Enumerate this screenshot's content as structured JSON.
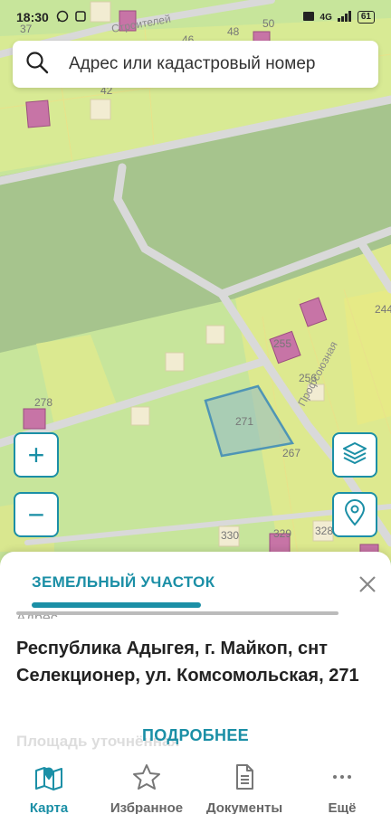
{
  "status_bar": {
    "time": "18:30",
    "network": "4G",
    "battery": "61"
  },
  "search": {
    "placeholder": "Адрес или кадастровый номер"
  },
  "map": {
    "street_label": "Строителей",
    "street_label_2": "Профсоюзная",
    "parcel_numbers": [
      "37",
      "46",
      "48",
      "50",
      "42",
      "244",
      "255",
      "256",
      "278",
      "271",
      "267",
      "330",
      "329",
      "328"
    ]
  },
  "map_controls": {
    "zoom_in": "+",
    "zoom_out": "−"
  },
  "sheet": {
    "tab_label": "ЗЕМЕЛЬНЫЙ УЧАСТОК",
    "address_label": "Адрес",
    "address_value": "Республика Адыгея, г. Майкоп, снт Селекционер, ул. Комсомольская, 271",
    "more_button": "ПОДРОБНЕЕ",
    "area_label": "Площадь уточнённая"
  },
  "bottom_nav": {
    "items": [
      {
        "label": "Карта",
        "icon": "map-icon",
        "active": true
      },
      {
        "label": "Избранное",
        "icon": "star-icon",
        "active": false
      },
      {
        "label": "Документы",
        "icon": "document-icon",
        "active": false
      },
      {
        "label": "Ещё",
        "icon": "more-icon",
        "active": false
      }
    ]
  },
  "colors": {
    "accent": "#1b8fa6",
    "map_green": "#c6e59a",
    "map_forest": "#a9c88a",
    "parcel_yellow": "#e3ec8f",
    "building": "#c774a6",
    "selected_parcel": "#8fb9c8"
  }
}
